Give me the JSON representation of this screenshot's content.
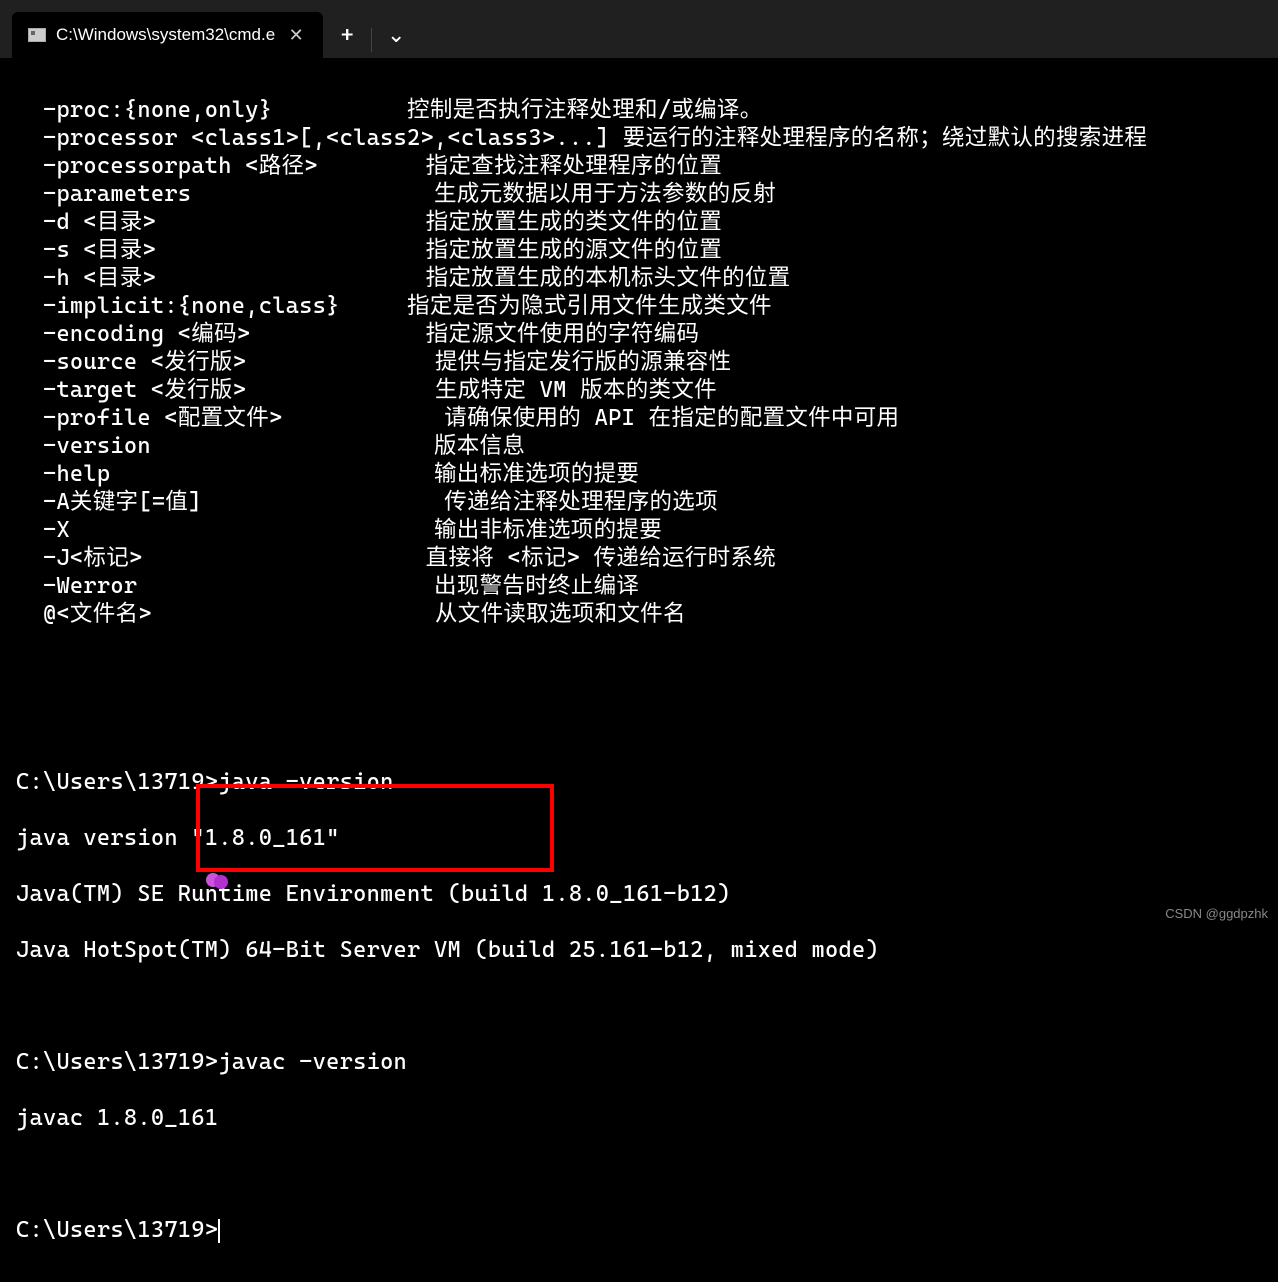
{
  "titlebar": {
    "tab_title": "C:\\Windows\\system32\\cmd.e",
    "close_label": "✕",
    "newtab_label": "+",
    "dropdown_label": "⌄"
  },
  "options": [
    {
      "flag": "  -proc:{none,only}",
      "pad": "          ",
      "desc": "控制是否执行注释处理和/或编译。"
    },
    {
      "flag": "  -processor <class1>[,<class2>,<class3>...]",
      "pad": " ",
      "desc": "要运行的注释处理程序的名称；绕过默认的搜索进程"
    },
    {
      "flag": "  -processorpath <路径>",
      "pad": "        ",
      "desc": "指定查找注释处理程序的位置"
    },
    {
      "flag": "  -parameters",
      "pad": "                  ",
      "desc": "生成元数据以用于方法参数的反射"
    },
    {
      "flag": "  -d <目录>",
      "pad": "                    ",
      "desc": "指定放置生成的类文件的位置"
    },
    {
      "flag": "  -s <目录>",
      "pad": "                    ",
      "desc": "指定放置生成的源文件的位置"
    },
    {
      "flag": "  -h <目录>",
      "pad": "                    ",
      "desc": "指定放置生成的本机标头文件的位置"
    },
    {
      "flag": "  -implicit:{none,class}",
      "pad": "     ",
      "desc": "指定是否为隐式引用文件生成类文件"
    },
    {
      "flag": "  -encoding <编码>",
      "pad": "             ",
      "desc": "指定源文件使用的字符编码"
    },
    {
      "flag": "  -source <发行版>",
      "pad": "              ",
      "desc": "提供与指定发行版的源兼容性"
    },
    {
      "flag": "  -target <发行版>",
      "pad": "              ",
      "desc": "生成特定 VM 版本的类文件"
    },
    {
      "flag": "  -profile <配置文件>",
      "pad": "            ",
      "desc": "请确保使用的 API 在指定的配置文件中可用"
    },
    {
      "flag": "  -version",
      "pad": "                     ",
      "desc": "版本信息"
    },
    {
      "flag": "  -help",
      "pad": "                        ",
      "desc": "输出标准选项的提要"
    },
    {
      "flag": "  -A关键字[=值]",
      "pad": "                  ",
      "desc": "传递给注释处理程序的选项"
    },
    {
      "flag": "  -X",
      "pad": "                           ",
      "desc": "输出非标准选项的提要"
    },
    {
      "flag": "  -J<标记>",
      "pad": "                     ",
      "desc": "直接将 <标记> 传递给运行时系统"
    },
    {
      "flag": "  -Werror",
      "pad": "                      ",
      "desc": "出现警告时终止编译"
    },
    {
      "flag": "  @<文件名>",
      "pad": "                     ",
      "desc": "从文件读取选项和文件名"
    }
  ],
  "session": {
    "prompt1": "C:\\Users\\13719>",
    "cmd1": "java -version",
    "out1_1": "java version \"1.8.0_161\"",
    "out1_2": "Java(TM) SE Runtime Environment (build 1.8.0_161-b12)",
    "out1_3": "Java HotSpot(TM) 64-Bit Server VM (build 25.161-b12, mixed mode)",
    "prompt2": "C:\\Users\\13719>",
    "cmd2": "javac -version",
    "out2_1": "javac 1.8.0_161",
    "prompt3": "C:\\Users\\13719>"
  },
  "watermark": "CSDN @ggdpzhk"
}
